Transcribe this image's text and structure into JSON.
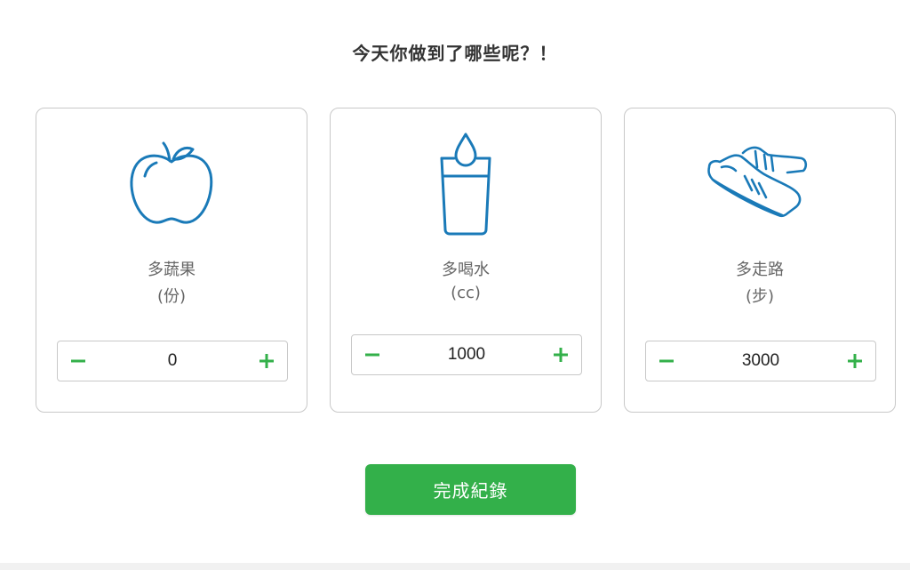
{
  "page": {
    "title": "今天你做到了哪些呢？！"
  },
  "colors": {
    "accent": "#33b04a",
    "icon": "#1a7ab8",
    "border": "#c8c8c8"
  },
  "cards": [
    {
      "icon": "apple-icon",
      "label": "多蔬果",
      "unit": "(份)",
      "value": "0"
    },
    {
      "icon": "water-glass-icon",
      "label": "多喝水",
      "unit": "(cc)",
      "value": "1000"
    },
    {
      "icon": "sneaker-icon",
      "label": "多走路",
      "unit": "(步)",
      "value": "3000"
    }
  ],
  "submit_label": "完成紀錄"
}
